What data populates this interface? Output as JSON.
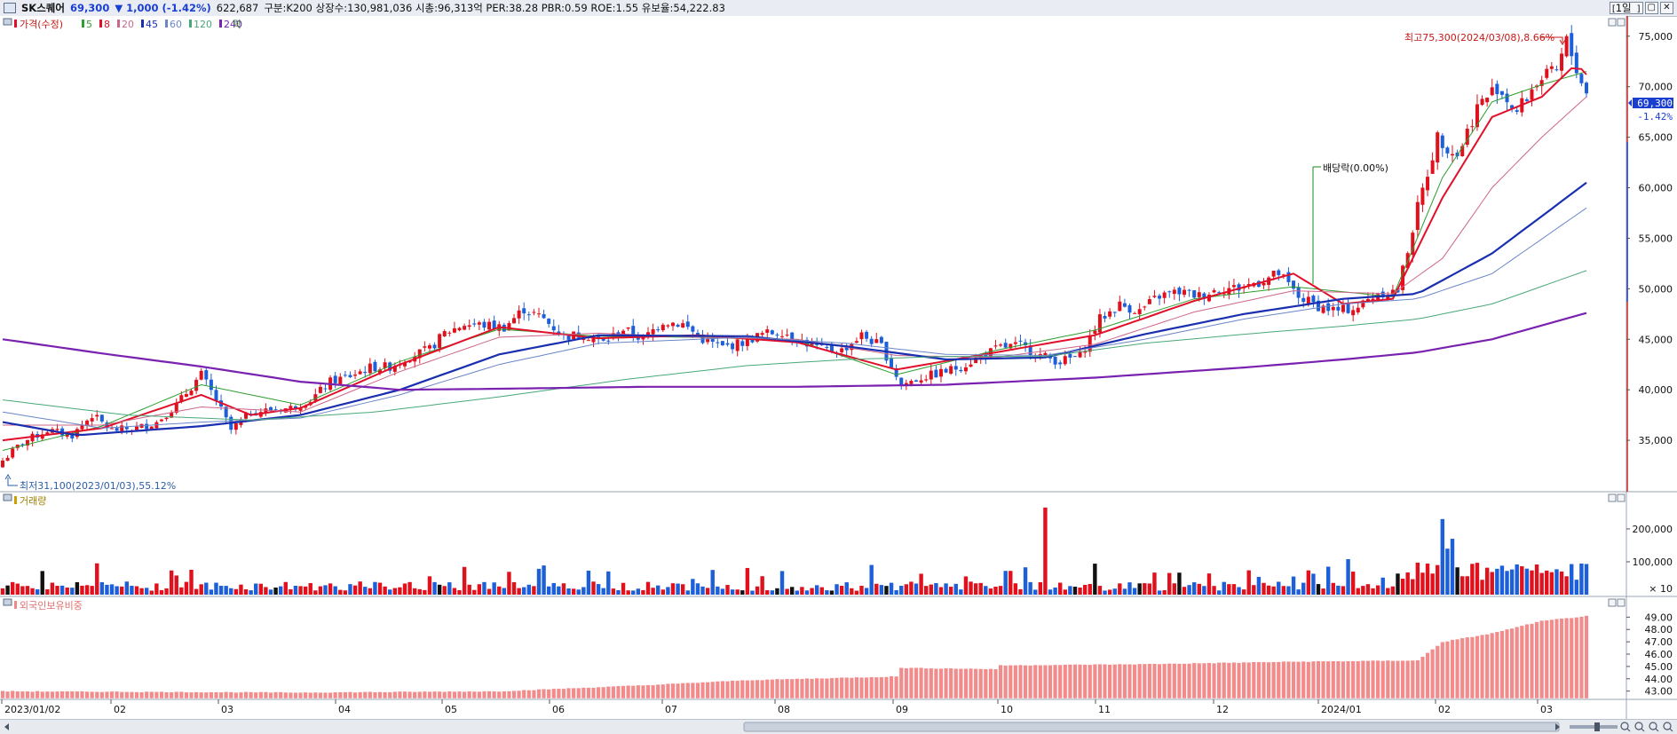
{
  "header": {
    "stock_name": "SK스퀘어",
    "price": "69,300",
    "change": "▼ 1,000  (-1.42%)",
    "volume": "622,687",
    "info": "구분:K200  상장수:130,981,036  시총:96,313억  PER:38.28  PBR:0.59  ROE:1.55  유보율:54,222.83",
    "period_button": "1일",
    "window_buttons": [
      "▢",
      "✕"
    ]
  },
  "legend": {
    "price_label": "가격(수정)",
    "ma_labels": [
      "5",
      "8",
      "20",
      "45",
      "60",
      "120",
      "240"
    ],
    "ma_colors": [
      "#2e9e2e",
      "#e0102a",
      "#cc6688",
      "#1a2fb0",
      "#6a86c8",
      "#48a878",
      "#7a22b0"
    ],
    "extra_label": "락"
  },
  "annotations": {
    "high": "최고75,300(2024/03/08),8.66%",
    "low": "최저31,100(2023/01/03),55.12%",
    "dividend": "배당락(0.00%)"
  },
  "current_price_tag": "69,300",
  "current_change_tag": "-1.42%",
  "volume_panel": {
    "title": "거래량",
    "unit_label": "× 10"
  },
  "foreign_panel": {
    "title": "외국인보유비중"
  },
  "x_axis_labels": [
    "2023/01/02",
    "02",
    "03",
    "04",
    "05",
    "06",
    "07",
    "08",
    "09",
    "10",
    "11",
    "12",
    "2024/01",
    "02",
    "03"
  ],
  "chart_data": [
    {
      "type": "candlestick",
      "title": "SK스퀘어",
      "ylim": [
        30000,
        77000
      ],
      "y_ticks": [
        35000,
        40000,
        45000,
        50000,
        55000,
        60000,
        65000,
        70000,
        75000
      ],
      "y_tick_labels": [
        "35,000",
        "40,000",
        "45,000",
        "50,000",
        "55,000",
        "60,000",
        "65,000",
        "70,000",
        "75,000"
      ],
      "x_months": [
        "2023/01",
        "2023/02",
        "2023/03",
        "2023/04",
        "2023/05",
        "2023/06",
        "2023/07",
        "2023/08",
        "2023/09",
        "2023/10",
        "2023/11",
        "2023/12",
        "2024/01",
        "2024/02",
        "2024/03"
      ],
      "close_path": [
        [
          0,
          33000
        ],
        [
          4,
          34800
        ],
        [
          9,
          36000
        ],
        [
          14,
          35500
        ],
        [
          18,
          37500
        ],
        [
          22,
          36000
        ],
        [
          27,
          36200
        ],
        [
          31,
          36800
        ],
        [
          35,
          38500
        ],
        [
          40,
          41500
        ],
        [
          43,
          39000
        ],
        [
          46,
          36000
        ],
        [
          50,
          37800
        ],
        [
          54,
          38000
        ],
        [
          58,
          38200
        ],
        [
          62,
          39000
        ],
        [
          66,
          40800
        ],
        [
          70,
          41400
        ],
        [
          74,
          42200
        ],
        [
          78,
          42300
        ],
        [
          82,
          43300
        ],
        [
          86,
          44000
        ],
        [
          89,
          45600
        ],
        [
          93,
          46500
        ],
        [
          97,
          46400
        ],
        [
          101,
          46200
        ],
        [
          105,
          48000
        ],
        [
          109,
          47000
        ],
        [
          113,
          45300
        ],
        [
          117,
          45500
        ],
        [
          121,
          44700
        ],
        [
          125,
          46000
        ],
        [
          129,
          45000
        ],
        [
          133,
          46800
        ],
        [
          137,
          46500
        ],
        [
          141,
          45000
        ],
        [
          145,
          44200
        ],
        [
          149,
          44700
        ],
        [
          153,
          45500
        ],
        [
          157,
          45800
        ],
        [
          161,
          44800
        ],
        [
          165,
          44000
        ],
        [
          169,
          43900
        ],
        [
          173,
          45400
        ],
        [
          177,
          44300
        ],
        [
          181,
          40500
        ],
        [
          185,
          41200
        ],
        [
          189,
          41700
        ],
        [
          193,
          42300
        ],
        [
          197,
          43300
        ],
        [
          201,
          44200
        ],
        [
          205,
          44400
        ],
        [
          209,
          43400
        ],
        [
          213,
          42800
        ],
        [
          217,
          43400
        ],
        [
          221,
          47000
        ],
        [
          225,
          48400
        ],
        [
          229,
          47800
        ],
        [
          233,
          49300
        ],
        [
          237,
          49700
        ],
        [
          241,
          49300
        ],
        [
          245,
          50000
        ],
        [
          249,
          50100
        ],
        [
          253,
          50700
        ],
        [
          257,
          51500
        ],
        [
          261,
          49200
        ],
        [
          265,
          48300
        ],
        [
          269,
          47800
        ],
        [
          273,
          48200
        ],
        [
          277,
          49600
        ],
        [
          281,
          49800
        ],
        [
          285,
          58000
        ],
        [
          289,
          65000
        ],
        [
          293,
          63200
        ],
        [
          297,
          68000
        ],
        [
          301,
          70000
        ],
        [
          305,
          67500
        ],
        [
          309,
          70500
        ],
        [
          313,
          71500
        ],
        [
          315,
          74500
        ],
        [
          317,
          71800
        ],
        [
          319,
          69300
        ]
      ],
      "moving_averages": [
        {
          "name": "5",
          "color": "#2e9e2e",
          "points": [
            [
              0,
              34000
            ],
            [
              20,
              36400
            ],
            [
              40,
              40500
            ],
            [
              60,
              38500
            ],
            [
              80,
              42800
            ],
            [
              100,
              46000
            ],
            [
              120,
              45300
            ],
            [
              140,
              45200
            ],
            [
              160,
              44900
            ],
            [
              180,
              41500
            ],
            [
              200,
              43900
            ],
            [
              220,
              45900
            ],
            [
              240,
              49000
            ],
            [
              260,
              50200
            ],
            [
              280,
              49200
            ],
            [
              290,
              61000
            ],
            [
              300,
              68500
            ],
            [
              310,
              70200
            ],
            [
              319,
              71500
            ]
          ]
        },
        {
          "name": "8",
          "color": "#e0102a",
          "points": [
            [
              0,
              35000
            ],
            [
              20,
              36200
            ],
            [
              40,
              39500
            ],
            [
              50,
              37500
            ],
            [
              60,
              38200
            ],
            [
              80,
              42500
            ],
            [
              100,
              46200
            ],
            [
              120,
              45100
            ],
            [
              140,
              45400
            ],
            [
              160,
              44700
            ],
            [
              180,
              42000
            ],
            [
              200,
              43700
            ],
            [
              220,
              45400
            ],
            [
              240,
              48800
            ],
            [
              260,
              51500
            ],
            [
              270,
              48500
            ],
            [
              280,
              49000
            ],
            [
              290,
              59000
            ],
            [
              300,
              67000
            ],
            [
              310,
              69000
            ],
            [
              317,
              72300
            ],
            [
              319,
              71200
            ]
          ]
        },
        {
          "name": "20",
          "color": "#cc6688",
          "points": [
            [
              0,
              36500
            ],
            [
              20,
              36500
            ],
            [
              40,
              38300
            ],
            [
              60,
              37800
            ],
            [
              80,
              41800
            ],
            [
              100,
              45200
            ],
            [
              120,
              45600
            ],
            [
              140,
              45200
            ],
            [
              160,
              45000
            ],
            [
              180,
              43400
            ],
            [
              200,
              43200
            ],
            [
              220,
              44500
            ],
            [
              240,
              47700
            ],
            [
              260,
              49800
            ],
            [
              280,
              49500
            ],
            [
              290,
              53000
            ],
            [
              300,
              60000
            ],
            [
              310,
              65000
            ],
            [
              319,
              69000
            ]
          ]
        },
        {
          "name": "45",
          "color": "#1a2fb0",
          "points": [
            [
              0,
              36800
            ],
            [
              15,
              35500
            ],
            [
              40,
              36400
            ],
            [
              60,
              37500
            ],
            [
              80,
              40000
            ],
            [
              100,
              43500
            ],
            [
              120,
              45400
            ],
            [
              150,
              45300
            ],
            [
              170,
              44300
            ],
            [
              190,
              43000
            ],
            [
              210,
              43200
            ],
            [
              230,
              45500
            ],
            [
              250,
              47500
            ],
            [
              270,
              49000
            ],
            [
              285,
              49500
            ],
            [
              300,
              53500
            ],
            [
              319,
              60500
            ]
          ]
        },
        {
          "name": "60",
          "color": "#6a86c8",
          "points": [
            [
              0,
              37800
            ],
            [
              20,
              36200
            ],
            [
              40,
              36800
            ],
            [
              60,
              37200
            ],
            [
              80,
              39500
            ],
            [
              100,
              42500
            ],
            [
              120,
              44600
            ],
            [
              150,
              45200
            ],
            [
              170,
              44600
            ],
            [
              190,
              43500
            ],
            [
              210,
              43400
            ],
            [
              230,
              45000
            ],
            [
              250,
              47000
            ],
            [
              270,
              48500
            ],
            [
              285,
              49000
            ],
            [
              300,
              51500
            ],
            [
              319,
              58000
            ]
          ]
        },
        {
          "name": "120",
          "color": "#48a878",
          "points": [
            [
              0,
              39000
            ],
            [
              25,
              37500
            ],
            [
              50,
              37000
            ],
            [
              75,
              37800
            ],
            [
              100,
              39300
            ],
            [
              125,
              41000
            ],
            [
              150,
              42400
            ],
            [
              170,
              43000
            ],
            [
              190,
              43300
            ],
            [
              210,
              43300
            ],
            [
              230,
              44600
            ],
            [
              250,
              45500
            ],
            [
              270,
              46300
            ],
            [
              285,
              47000
            ],
            [
              300,
              48500
            ],
            [
              319,
              51800
            ]
          ]
        },
        {
          "name": "240",
          "color": "#7a22b0",
          "points": [
            [
              0,
              45000
            ],
            [
              20,
              43600
            ],
            [
              40,
              42300
            ],
            [
              60,
              40800
            ],
            [
              80,
              40000
            ],
            [
              100,
              40100
            ],
            [
              130,
              40300
            ],
            [
              160,
              40300
            ],
            [
              190,
              40500
            ],
            [
              220,
              41200
            ],
            [
              250,
              42200
            ],
            [
              270,
              43000
            ],
            [
              285,
              43700
            ],
            [
              300,
              45000
            ],
            [
              319,
              47600
            ]
          ]
        }
      ]
    },
    {
      "type": "bar",
      "title": "거래량",
      "unit": "× 10",
      "ylim": [
        0,
        270000
      ],
      "y_ticks": [
        100000,
        200000
      ],
      "y_tick_labels": [
        "100,000",
        "200,000"
      ],
      "peaks": [
        {
          "label": "2023/09",
          "value": 265000
        },
        {
          "label": "2024/02",
          "value": 230000
        }
      ]
    },
    {
      "type": "bar",
      "title": "외국인보유비중",
      "ylim": [
        42.4,
        49.6
      ],
      "y_ticks": [
        43,
        44,
        45,
        46,
        47,
        48,
        49
      ],
      "y_tick_labels": [
        "43.00",
        "44.00",
        "45.00",
        "46.00",
        "47.00",
        "48.00",
        "49.00"
      ],
      "path": [
        [
          0,
          43.0
        ],
        [
          60,
          42.9
        ],
        [
          100,
          43.0
        ],
        [
          130,
          43.5
        ],
        [
          150,
          43.9
        ],
        [
          180,
          44.2
        ],
        [
          181,
          44.9
        ],
        [
          200,
          44.8
        ],
        [
          201,
          45.1
        ],
        [
          230,
          45.2
        ],
        [
          260,
          45.4
        ],
        [
          285,
          45.5
        ],
        [
          290,
          47.0
        ],
        [
          300,
          47.7
        ],
        [
          310,
          48.7
        ],
        [
          319,
          49.1
        ]
      ]
    }
  ]
}
